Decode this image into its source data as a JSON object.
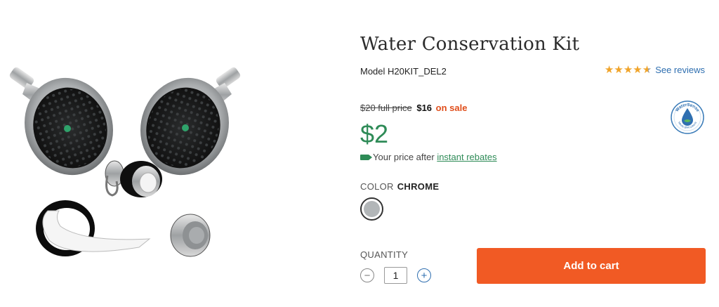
{
  "product": {
    "title": "Water Conservation Kit",
    "model": "Model H20KIT_DEL2",
    "image_alt": "Water Conservation Kit: two chrome showerheads, aerators and thread seal tape"
  },
  "rating": {
    "value": 4.6,
    "max": 5,
    "see_reviews_label": "See reviews"
  },
  "pricing": {
    "full_price": "$20 full price",
    "sale_price": "$16",
    "sale_label": "on sale",
    "final_price": "$2",
    "rebate_text": "Your price after",
    "rebate_link": "instant rebates"
  },
  "badge": {
    "icon": "watersense-icon",
    "text": "WaterSense",
    "subtext": "Meets EPA Criteria"
  },
  "color": {
    "label": "COLOR",
    "selected": "CHROME",
    "swatch_color": "#b2b6b8"
  },
  "quantity": {
    "label": "QUANTITY",
    "value": "1",
    "minus_icon": "minus-icon",
    "plus_icon": "plus-icon"
  },
  "cart": {
    "add_label": "Add to cart",
    "button_color": "#f15a24"
  },
  "colors": {
    "price_green": "#2e8b57",
    "sale_orange": "#e04e1b",
    "link_blue": "#2f6fb0",
    "star_gold": "#f0a42a"
  }
}
